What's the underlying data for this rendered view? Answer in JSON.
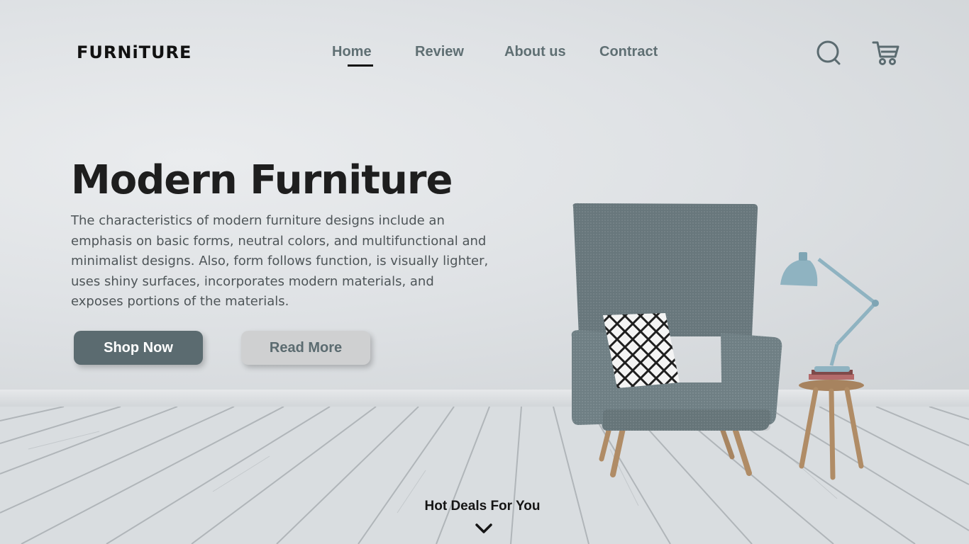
{
  "brand": {
    "logo": "FURNiTURE"
  },
  "nav": {
    "items": [
      {
        "label": "Home",
        "active": true
      },
      {
        "label": "Review",
        "active": false
      },
      {
        "label": "About us",
        "active": false
      },
      {
        "label": "Contract",
        "active": false
      }
    ]
  },
  "header_icons": {
    "search": "search-icon",
    "cart": "cart-icon"
  },
  "hero": {
    "title": "Modern Furniture",
    "description": "The characteristics of modern furniture designs include an emphasis on basic forms, neutral colors, and multifunctional and minimalist designs. Also, form follows function, is visually lighter, uses shiny surfaces, incorporates modern materials, and exposes portions of the materials.",
    "primary_button": "Shop Now",
    "secondary_button": "Read More"
  },
  "footer": {
    "deals_label": "Hot Deals For You",
    "scroll_icon": "chevron-down-icon"
  },
  "colors": {
    "accent": "#5b6b70",
    "secondary_btn": "#cfd0d1",
    "text_dark": "#1e1e1e",
    "nav_text": "#5f6f73"
  }
}
